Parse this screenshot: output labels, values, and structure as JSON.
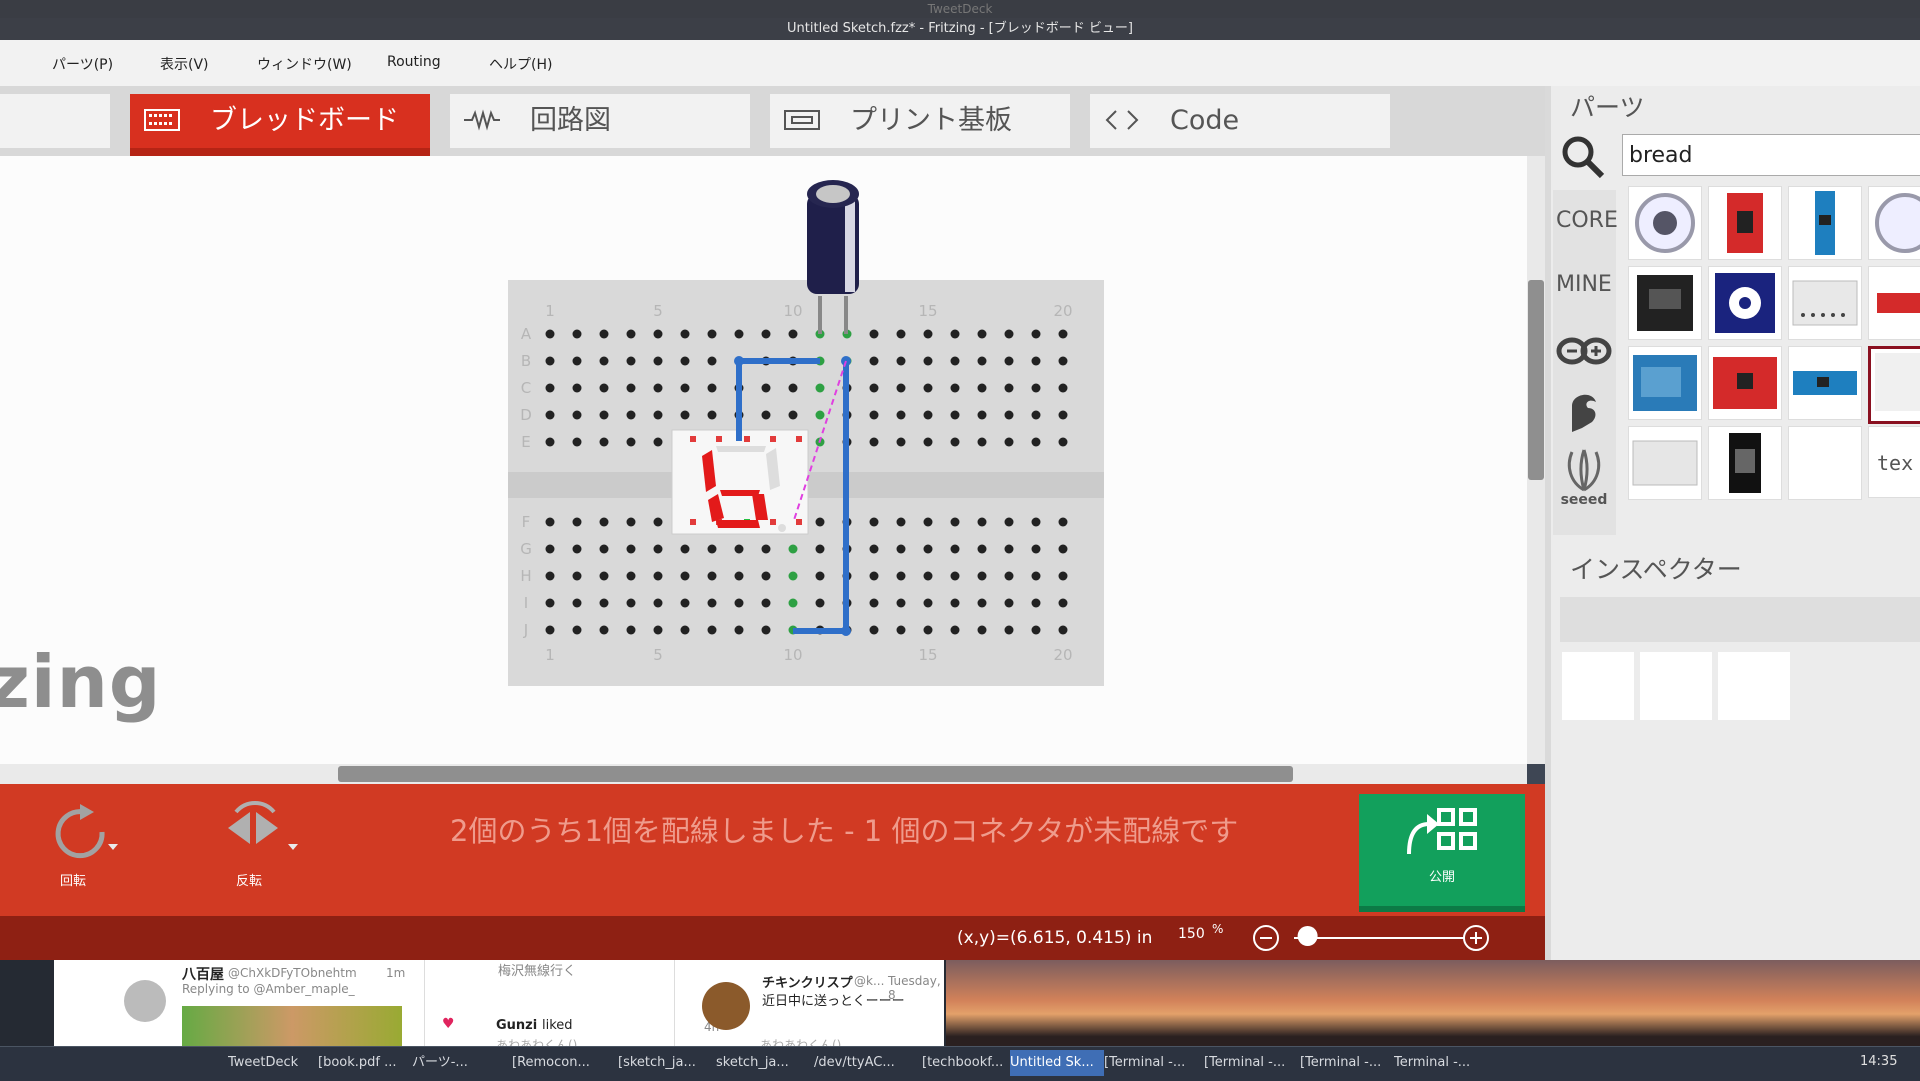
{
  "window": {
    "background_title": "TweetDeck",
    "title": "Untitled Sketch.fzz* - Fritzing - [ブレッドボード ビュー]"
  },
  "menu": [
    "パーツ(P)",
    "表示(V)",
    "ウィンドウ(W)",
    "Routing",
    "ヘルプ(H)"
  ],
  "tabs": [
    {
      "label": "ブレッドボード",
      "icon": "breadboard-icon",
      "active": true
    },
    {
      "label": "回路図",
      "icon": "resistor-icon",
      "active": false
    },
    {
      "label": "プリント基板",
      "icon": "pcb-icon",
      "active": false
    },
    {
      "label": "Code",
      "icon": "code-brackets-icon",
      "active": false
    }
  ],
  "watermark": "zing",
  "breadboard": {
    "top_numbers": [
      "1",
      "5",
      "10",
      "15",
      "20"
    ],
    "bottom_numbers": [
      "1",
      "5",
      "10",
      "15",
      "20"
    ],
    "top_rows": [
      "A",
      "B",
      "C",
      "D",
      "E"
    ],
    "bottom_rows": [
      "F",
      "G",
      "H",
      "I",
      "J"
    ]
  },
  "status": {
    "rotate_label": "回転",
    "flip_label": "反転",
    "routing_message": "2個のうち1個を配線しました - 1 個のコネクタが未配線です",
    "publish_label": "公開",
    "coordinates": "(x,y)=(6.615, 0.415) in",
    "zoom": "150",
    "zoom_unit": "%",
    "zoom_level": 0.08
  },
  "parts_panel": {
    "title": "パーツ",
    "search_value": "bread",
    "bins": [
      "CORE",
      "MINE",
      "seeed"
    ],
    "partial_part_text": "tex"
  },
  "inspector": {
    "title": "インスペクター"
  },
  "tweetdeck": {
    "col1_user": "八百屋",
    "col1_handle": "@ChXkDFyTObnehtm",
    "col1_time": "1m",
    "col1_reply": "Replying to @Amber_maple_",
    "col2_text": "梅沢無線行く",
    "col2_like_user": "Gunzi",
    "col2_like_text": "liked",
    "col2_time": "4h",
    "col2_partial": "あわあわくん()",
    "col3_user": "チキンクリスプ",
    "col3_handle": "@k...",
    "col3_time": "Tuesday, 8",
    "col3_text": "近日中に送っとくーーー",
    "col3_partial": "あわあわくん()"
  },
  "taskbar": {
    "items": [
      "TweetDeck",
      "[book.pdf ...",
      "パーツ-...",
      "[Remocon...",
      "[sketch_ja...",
      "sketch_ja...",
      "/dev/ttyAC...",
      "[techbookf...",
      "Untitled Sk...",
      "[Terminal -...",
      "[Terminal -...",
      "[Terminal -...",
      "Terminal -..."
    ],
    "clock": "14:35"
  },
  "colors": {
    "accent_red": "#d8301f",
    "publish_green": "#12a05c",
    "wire_blue": "#2f6fc9",
    "ratsnest_pink": "#e040e0"
  }
}
